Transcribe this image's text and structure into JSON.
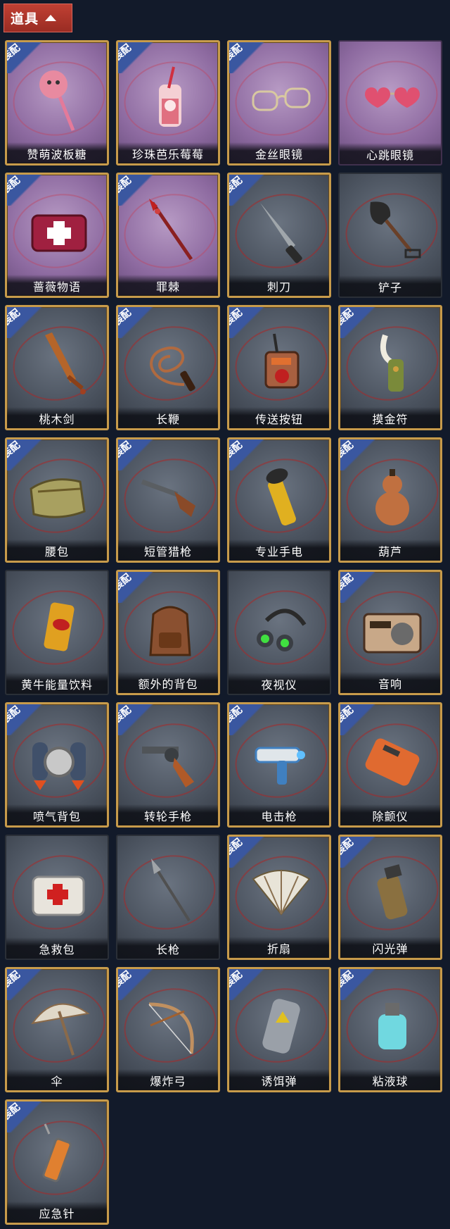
{
  "header": {
    "title": "道具"
  },
  "equip_badge": "装配",
  "items": [
    {
      "name": "赞萌波板糖",
      "bg": "purple",
      "gold": true,
      "equipped": true,
      "icon": "lollipop-icon",
      "color": "#e88aa0"
    },
    {
      "name": "珍珠芭乐莓莓",
      "bg": "purple",
      "gold": true,
      "equipped": true,
      "icon": "bubble-tea-icon",
      "color": "#e07080"
    },
    {
      "name": "金丝眼镜",
      "bg": "purple",
      "gold": true,
      "equipped": true,
      "icon": "glasses-icon",
      "color": "#d8c8a0"
    },
    {
      "name": "心跳眼镜",
      "bg": "purple",
      "gold": false,
      "equipped": false,
      "icon": "heart-glasses-icon",
      "color": "#e05070"
    },
    {
      "name": "蔷薇物语",
      "bg": "purple",
      "gold": true,
      "equipped": true,
      "icon": "medkit-rose-icon",
      "color": "#a02040"
    },
    {
      "name": "罪棘",
      "bg": "purple",
      "gold": true,
      "equipped": true,
      "icon": "thorn-spear-icon",
      "color": "#8a2020"
    },
    {
      "name": "刺刀",
      "bg": "grey",
      "gold": true,
      "equipped": true,
      "icon": "bayonet-icon",
      "color": "#a0a6ab"
    },
    {
      "name": "铲子",
      "bg": "grey",
      "gold": false,
      "equipped": false,
      "icon": "shovel-icon",
      "color": "#6a4028"
    },
    {
      "name": "桃木剑",
      "bg": "grey",
      "gold": true,
      "equipped": true,
      "icon": "wooden-sword-icon",
      "color": "#b5652a"
    },
    {
      "name": "长鞭",
      "bg": "grey",
      "gold": true,
      "equipped": true,
      "icon": "whip-icon",
      "color": "#b06a40"
    },
    {
      "name": "传送按钮",
      "bg": "grey",
      "gold": true,
      "equipped": true,
      "icon": "teleport-button-icon",
      "color": "#a86040"
    },
    {
      "name": "摸金符",
      "bg": "grey",
      "gold": true,
      "equipped": true,
      "icon": "amulet-icon",
      "color": "#7a8a3a"
    },
    {
      "name": "腰包",
      "bg": "grey",
      "gold": true,
      "equipped": true,
      "icon": "waist-bag-icon",
      "color": "#a8a060"
    },
    {
      "name": "短管猎枪",
      "bg": "grey",
      "gold": true,
      "equipped": true,
      "icon": "shotgun-icon",
      "color": "#8a4a28"
    },
    {
      "name": "专业手电",
      "bg": "grey",
      "gold": true,
      "equipped": true,
      "icon": "flashlight-icon",
      "color": "#e0b020"
    },
    {
      "name": "葫芦",
      "bg": "grey",
      "gold": true,
      "equipped": true,
      "icon": "gourd-icon",
      "color": "#c07040"
    },
    {
      "name": "黄牛能量饮料",
      "bg": "grey",
      "gold": false,
      "equipped": false,
      "icon": "energy-drink-icon",
      "color": "#e0a020"
    },
    {
      "name": "额外的背包",
      "bg": "grey",
      "gold": true,
      "equipped": true,
      "icon": "backpack-icon",
      "color": "#8a5030"
    },
    {
      "name": "夜视仪",
      "bg": "grey",
      "gold": false,
      "equipped": false,
      "icon": "night-vision-icon",
      "color": "#3a3e44"
    },
    {
      "name": "音响",
      "bg": "grey",
      "gold": true,
      "equipped": true,
      "icon": "radio-icon",
      "color": "#c8a888"
    },
    {
      "name": "喷气背包",
      "bg": "grey",
      "gold": true,
      "equipped": true,
      "icon": "jetpack-icon",
      "color": "#40506a"
    },
    {
      "name": "转轮手枪",
      "bg": "grey",
      "gold": true,
      "equipped": true,
      "icon": "revolver-icon",
      "color": "#505458"
    },
    {
      "name": "电击枪",
      "bg": "grey",
      "gold": true,
      "equipped": true,
      "icon": "shock-gun-icon",
      "color": "#4080c0"
    },
    {
      "name": "除颤仪",
      "bg": "grey",
      "gold": true,
      "equipped": true,
      "icon": "defibrillator-icon",
      "color": "#e06a30"
    },
    {
      "name": "急救包",
      "bg": "grey",
      "gold": false,
      "equipped": false,
      "icon": "first-aid-icon",
      "color": "#e8e4dc"
    },
    {
      "name": "长枪",
      "bg": "grey",
      "gold": false,
      "equipped": false,
      "icon": "spear-icon",
      "color": "#505050"
    },
    {
      "name": "折扇",
      "bg": "grey",
      "gold": true,
      "equipped": true,
      "icon": "folding-fan-icon",
      "color": "#e8e4d8"
    },
    {
      "name": "闪光弹",
      "bg": "grey",
      "gold": true,
      "equipped": true,
      "icon": "flashbang-icon",
      "color": "#8a7040"
    },
    {
      "name": "伞",
      "bg": "grey",
      "gold": true,
      "equipped": true,
      "icon": "umbrella-icon",
      "color": "#e0d8c8"
    },
    {
      "name": "爆炸弓",
      "bg": "grey",
      "gold": true,
      "equipped": true,
      "icon": "bow-icon",
      "color": "#c09060"
    },
    {
      "name": "诱饵弹",
      "bg": "grey",
      "gold": true,
      "equipped": true,
      "icon": "decoy-icon",
      "color": "#9aa0a8"
    },
    {
      "name": "粘液球",
      "bg": "grey",
      "gold": true,
      "equipped": true,
      "icon": "slime-ball-icon",
      "color": "#70d8e0"
    },
    {
      "name": "应急针",
      "bg": "grey",
      "gold": true,
      "equipped": true,
      "icon": "syringe-icon",
      "color": "#e08030"
    }
  ]
}
